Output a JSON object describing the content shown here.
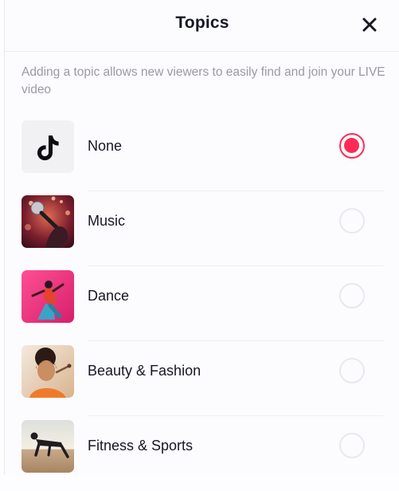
{
  "header": {
    "title": "Topics",
    "close_icon": "close-icon"
  },
  "description": "Adding a topic allows new viewers to easily find and join your LIVE video",
  "topics": [
    {
      "label": "None",
      "icon": "tiktok-logo-icon",
      "selected": true
    },
    {
      "label": "Music",
      "icon": "music-photo",
      "selected": false
    },
    {
      "label": "Dance",
      "icon": "dance-photo",
      "selected": false
    },
    {
      "label": "Beauty & Fashion",
      "icon": "beauty-photo",
      "selected": false
    },
    {
      "label": "Fitness & Sports",
      "icon": "fitness-photo",
      "selected": false
    }
  ],
  "colors": {
    "accent": "#fe2c55",
    "text": "#161823",
    "muted": "#9b9aa3"
  }
}
